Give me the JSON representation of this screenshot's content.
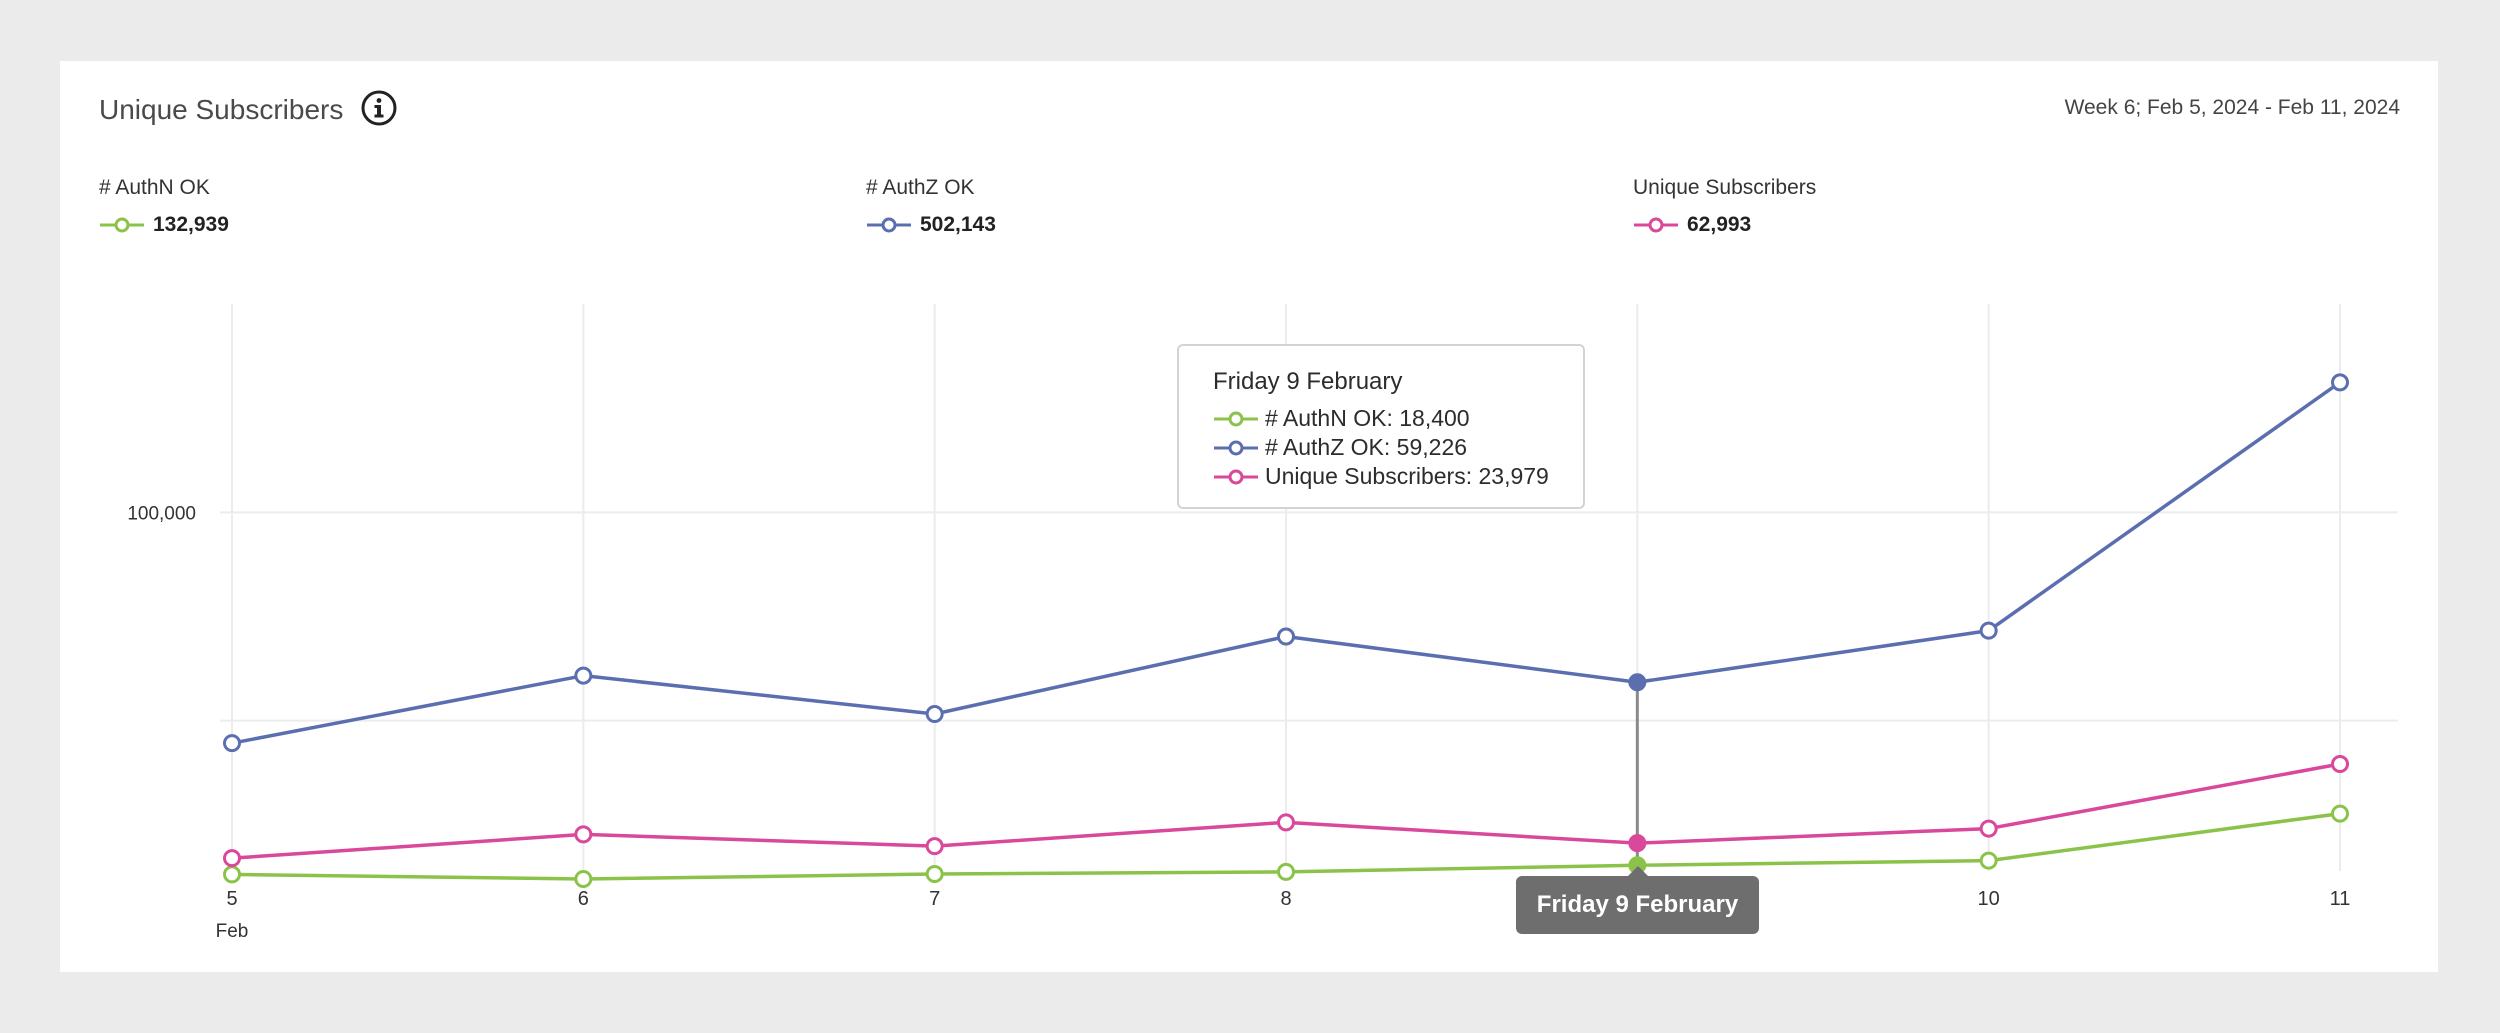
{
  "header": {
    "title": "Unique Subscribers",
    "date_range": "Week 6; Feb 5, 2024 - Feb 11, 2024"
  },
  "summary": [
    {
      "label": "# AuthN OK",
      "value": "132,939",
      "color": "#8bc34a"
    },
    {
      "label": "# AuthZ OK",
      "value": "502,143",
      "color": "#5b6fb0"
    },
    {
      "label": "Unique Subscribers",
      "value": "62,993",
      "color": "#d9489a"
    }
  ],
  "tooltip": {
    "title": "Friday 9 February",
    "rows": [
      {
        "text": "# AuthN OK: 18,400",
        "color": "#8bc34a"
      },
      {
        "text": "# AuthZ OK: 59,226",
        "color": "#5b6fb0"
      },
      {
        "text": "Unique Subscribers: 23,979",
        "color": "#d9489a"
      }
    ]
  },
  "x_tooltip": "Friday 9 February",
  "chart_data": {
    "type": "line",
    "categories": [
      "5",
      "6",
      "7",
      "8",
      "9",
      "10",
      "11"
    ],
    "x_sub_label": "Feb",
    "yticks": [
      {
        "value": 100000,
        "label": "100,000"
      }
    ],
    "ylim": [
      0,
      150000
    ],
    "grid": true,
    "highlight_index": 4,
    "series": [
      {
        "name": "# AuthN OK",
        "color": "#8bc34a",
        "values": [
          13100,
          12000,
          13200,
          13700,
          15300,
          16400,
          27700
        ]
      },
      {
        "name": "# AuthZ OK",
        "color": "#5b6fb0",
        "values": [
          44600,
          60800,
          51600,
          70200,
          59226,
          71600,
          131200
        ]
      },
      {
        "name": "Unique Subscribers",
        "color": "#d9489a",
        "values": [
          17000,
          22700,
          19900,
          25600,
          20600,
          24100,
          39600
        ]
      }
    ]
  }
}
